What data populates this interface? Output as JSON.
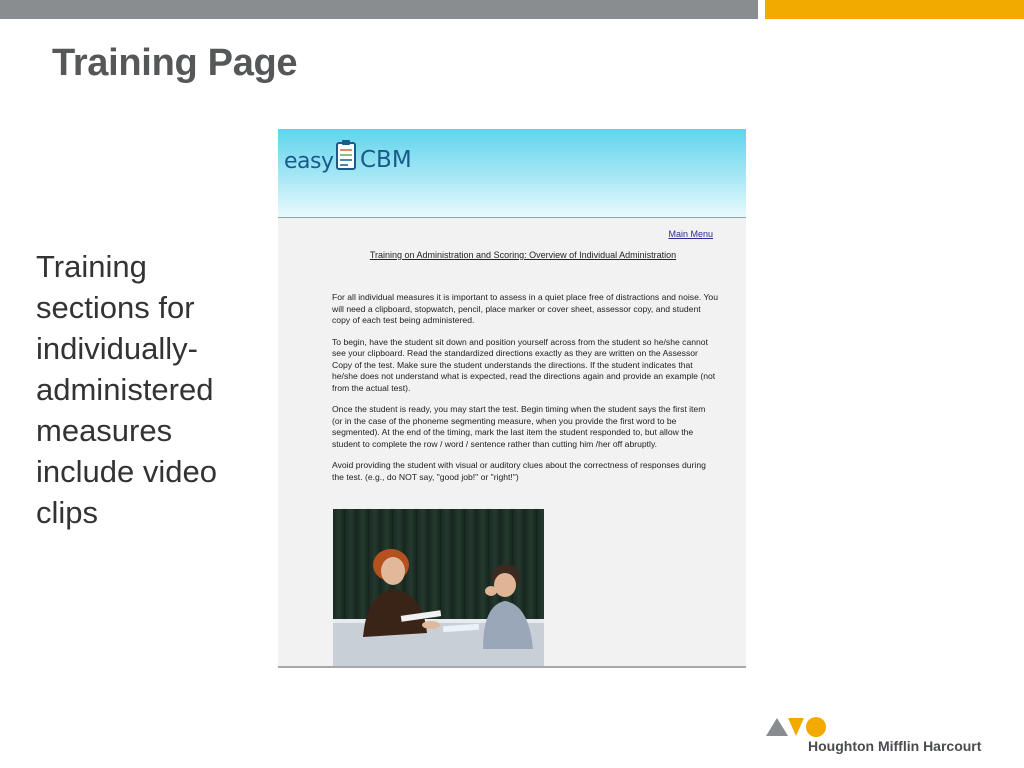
{
  "slide": {
    "title": "Training Page",
    "bullet": "Training sections for individually-administered measures include video clips"
  },
  "screenshot": {
    "logo": {
      "easy": "easy",
      "cbm": "CBM"
    },
    "main_menu": "Main Menu",
    "heading": "Training on Administration and Scoring: Overview of Individual Administration",
    "paragraphs": [
      "For all individual measures it is important to assess in a quiet place free of distractions and noise. You will need a clipboard, stopwatch, pencil, place marker or cover sheet, assessor copy, and student copy of each test being administered.",
      "To begin, have the student sit down and position yourself across from the student so he/she cannot see your clipboard. Read the standardized directions exactly as they are written on the Assessor Copy of the test. Make sure the student understands the directions. If the student indicates that he/she does not understand what is expected, read the directions again and provide an example (not from the actual test).",
      "Once the student is ready, you may start the test. Begin timing when the student says the first item (or in the case of the phoneme segmenting measure, when you provide the first word to be segmented). At the end of the timing, mark the last item the student responded to, but allow the student to complete the row / word / sentence rather than cutting him /her off abruptly.",
      "Avoid providing the student with visual or auditory clues about the correctness of responses during the test. (e.g., do NOT say, \"good job!\" or \"right!\")"
    ]
  },
  "footer": {
    "brand": "Houghton Mifflin Harcourt"
  },
  "colors": {
    "top_bar_gray": "#8a8d8f",
    "top_bar_gold": "#f2a900",
    "title": "#555759"
  }
}
